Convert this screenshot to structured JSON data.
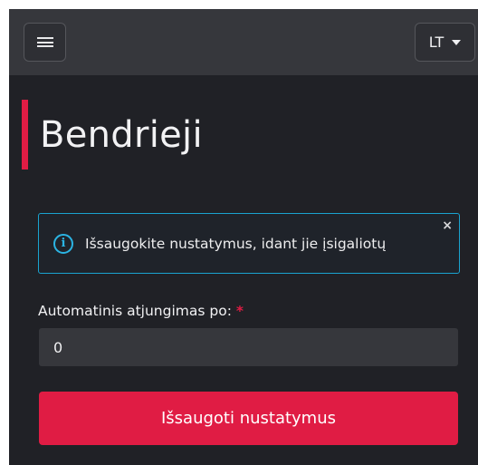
{
  "header": {
    "menu_icon": "hamburger-icon",
    "language": "LT",
    "language_icon": "caret-down-icon"
  },
  "page": {
    "title": "Bendrieji"
  },
  "alert": {
    "icon": "info-icon",
    "icon_glyph": "i",
    "message": "Išsaugokite nustatymus, idant jie įsigaliotų",
    "close_glyph": "×"
  },
  "form": {
    "auto_logout": {
      "label": "Automatinis atjungimas po:",
      "required_mark": "*",
      "value": "0"
    },
    "save_label": "Išsaugoti nustatymus"
  },
  "colors": {
    "background": "#202126",
    "navbar": "#36373c",
    "accent": "#e01c44",
    "info": "#2bb4e3"
  }
}
